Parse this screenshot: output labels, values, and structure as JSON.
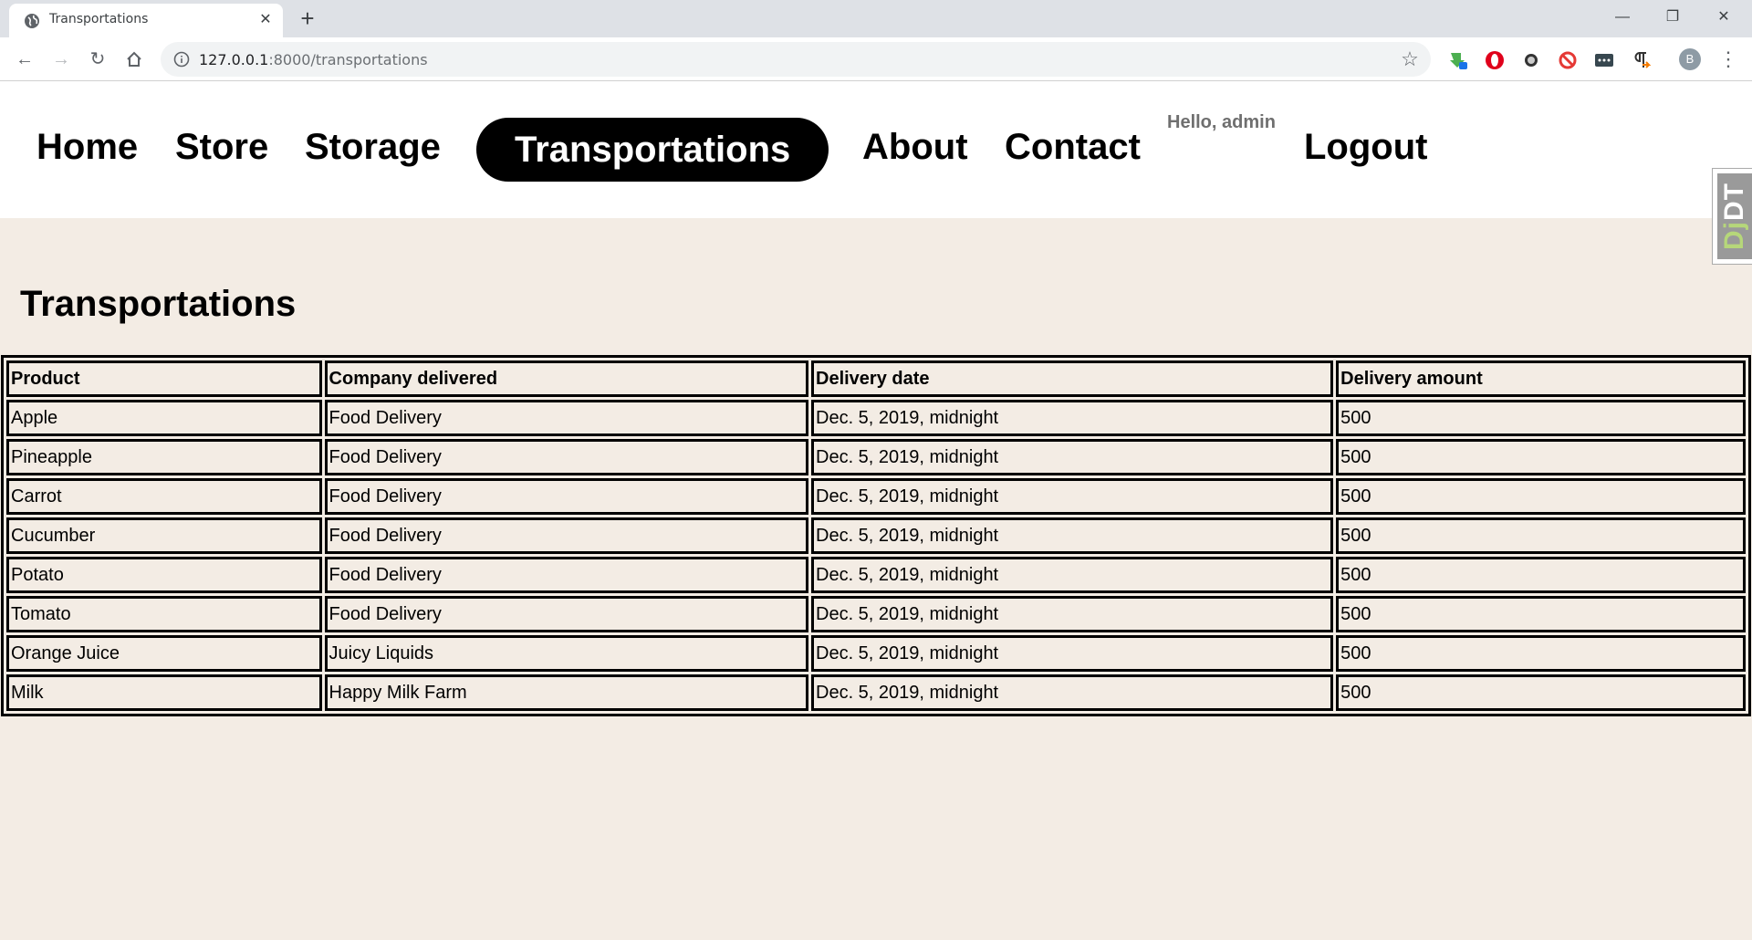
{
  "browser": {
    "tab_title": "Transportations",
    "url_host": "127.0.0.1",
    "url_rest": ":8000/transportations",
    "profile_initial": "B"
  },
  "nav": {
    "home": "Home",
    "store": "Store",
    "storage": "Storage",
    "transportations": "Transportations",
    "about": "About",
    "contact": "Contact",
    "greeting": "Hello, admin",
    "logout": "Logout"
  },
  "debug_toolbar": {
    "prefix": "Dj",
    "suffix": "DT"
  },
  "page": {
    "title": "Transportations"
  },
  "table": {
    "headers": [
      "Product",
      "Company delivered",
      "Delivery date",
      "Delivery amount"
    ],
    "rows": [
      [
        "Apple",
        "Food Delivery",
        "Dec. 5, 2019, midnight",
        "500"
      ],
      [
        "Pineapple",
        "Food Delivery",
        "Dec. 5, 2019, midnight",
        "500"
      ],
      [
        "Carrot",
        "Food Delivery",
        "Dec. 5, 2019, midnight",
        "500"
      ],
      [
        "Cucumber",
        "Food Delivery",
        "Dec. 5, 2019, midnight",
        "500"
      ],
      [
        "Potato",
        "Food Delivery",
        "Dec. 5, 2019, midnight",
        "500"
      ],
      [
        "Tomato",
        "Food Delivery",
        "Dec. 5, 2019, midnight",
        "500"
      ],
      [
        "Orange Juice",
        "Juicy Liquids",
        "Dec. 5, 2019, midnight",
        "500"
      ],
      [
        "Milk",
        "Happy Milk Farm",
        "Dec. 5, 2019, midnight",
        "500"
      ]
    ]
  }
}
